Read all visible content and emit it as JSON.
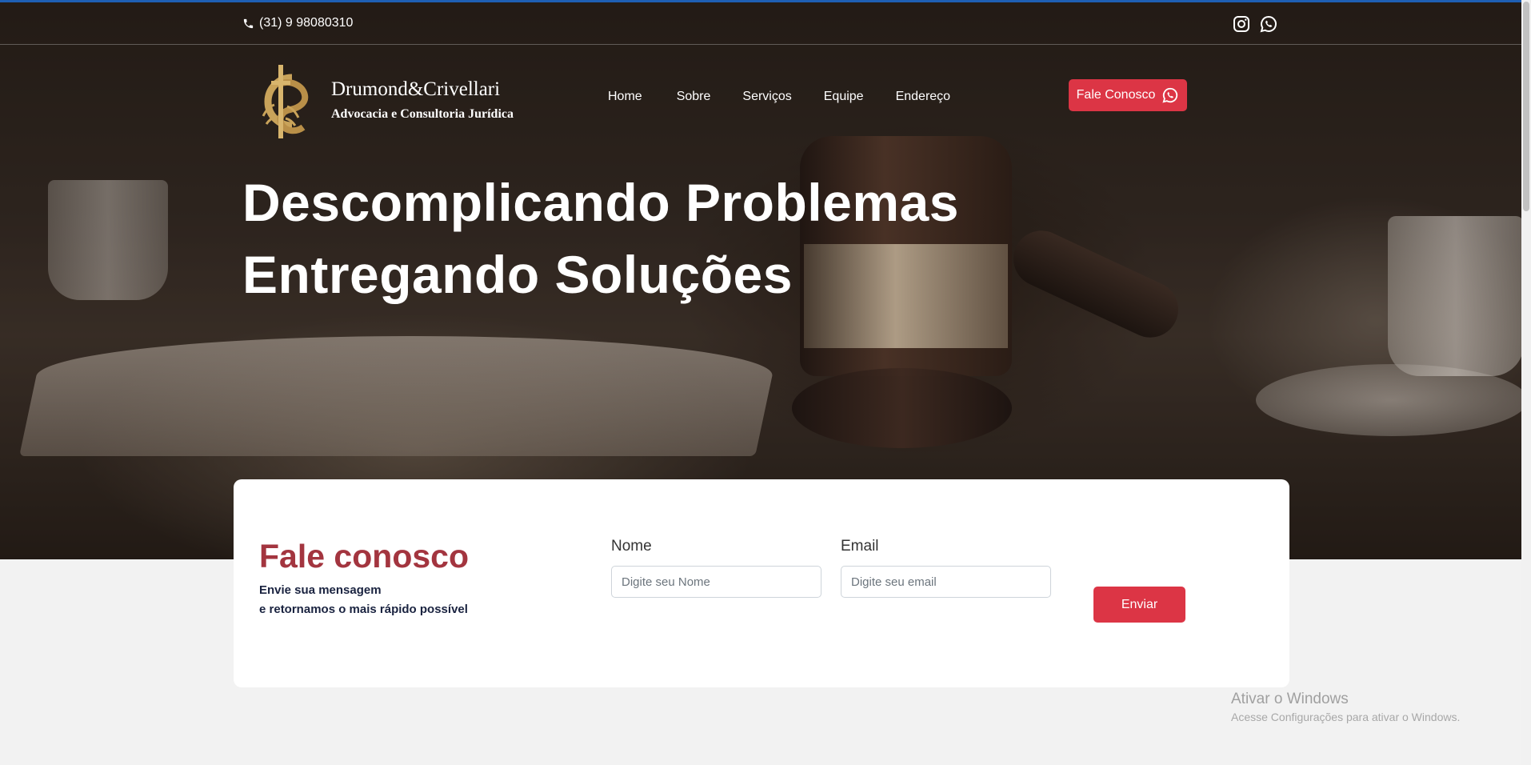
{
  "topbar": {
    "phone": "(31) 9 98080310",
    "social_icons": [
      "instagram-icon",
      "whatsapp-icon"
    ]
  },
  "brand": {
    "name": "Drumond&Crivellari",
    "tagline": "Advocacia e Consultoria Jurídica"
  },
  "nav": {
    "items": [
      {
        "label": "Home"
      },
      {
        "label": "Sobre"
      },
      {
        "label": "Serviços"
      },
      {
        "label": "Equipe"
      },
      {
        "label": "Endereço"
      }
    ],
    "cta_label": "Fale Conosco"
  },
  "hero": {
    "line1": "Descomplicando Problemas",
    "line2": "Entregando Soluções"
  },
  "contact": {
    "title": "Fale conosco",
    "text_line1": "Envie sua mensagem",
    "text_line2": "e retornamos o mais rápido possível",
    "name_label": "Nome",
    "name_placeholder": "Digite seu Nome",
    "email_label": "Email",
    "email_placeholder": "Digite seu email",
    "submit_label": "Enviar"
  },
  "windows_watermark": {
    "title": "Ativar o Windows",
    "subtitle": "Acesse Configurações para ativar o Windows."
  },
  "colors": {
    "accent": "#dc3545",
    "title_red": "#a3353f",
    "navy": "#1a2340",
    "gold": "#c9a35a"
  }
}
